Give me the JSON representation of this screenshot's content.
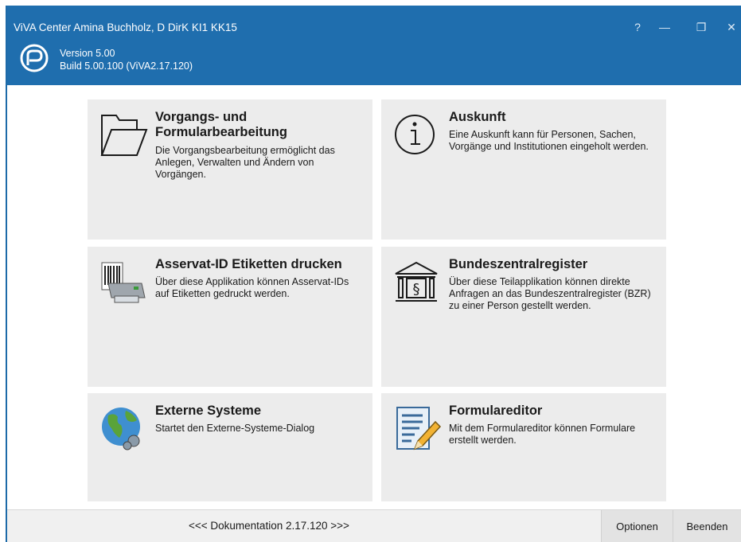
{
  "window": {
    "title": "ViVA Center Amina Buchholz, D DirK KI1 KK15",
    "version": "Version 5.00",
    "build": "Build 5.00.100 (ViVA2.17.120)",
    "controls": {
      "help": "?",
      "minimize": "—",
      "maximize": "❐",
      "close": "✕"
    }
  },
  "tiles": [
    {
      "title": "Vorgangs- und Formularbearbeitung",
      "description": "Die Vorgangsbearbeitung ermöglicht das Anlegen, Verwalten und Ändern von Vorgängen.",
      "icon": "folder-icon"
    },
    {
      "title": "Auskunft",
      "description": "Eine Auskunft kann für Personen, Sachen, Vorgänge und Institutionen eingeholt werden.",
      "icon": "info-icon"
    },
    {
      "title": "Asservat-ID Etiketten drucken",
      "description": "Über diese Applikation können Asservat-IDs auf Etiketten gedruckt werden.",
      "icon": "label-printer-icon"
    },
    {
      "title": "Bundeszentralregister",
      "description": "Über diese Teilapplikation können direkte Anfragen an das Bundeszentralregister (BZR) zu einer Person gestellt werden.",
      "icon": "court-building-icon"
    },
    {
      "title": "Externe Systeme",
      "description": "Startet den Externe-Systeme-Dialog",
      "icon": "globe-icon"
    },
    {
      "title": "Formulareditor",
      "description": "Mit dem Formulareditor können Formulare erstellt werden.",
      "icon": "form-editor-icon"
    }
  ],
  "footer": {
    "documentation": "<<< Dokumentation 2.17.120 >>>",
    "options": "Optionen",
    "quit": "Beenden"
  },
  "colors": {
    "titlebar": "#1f6eae",
    "tile": "#ececec",
    "footer": "#f0f0f0"
  }
}
